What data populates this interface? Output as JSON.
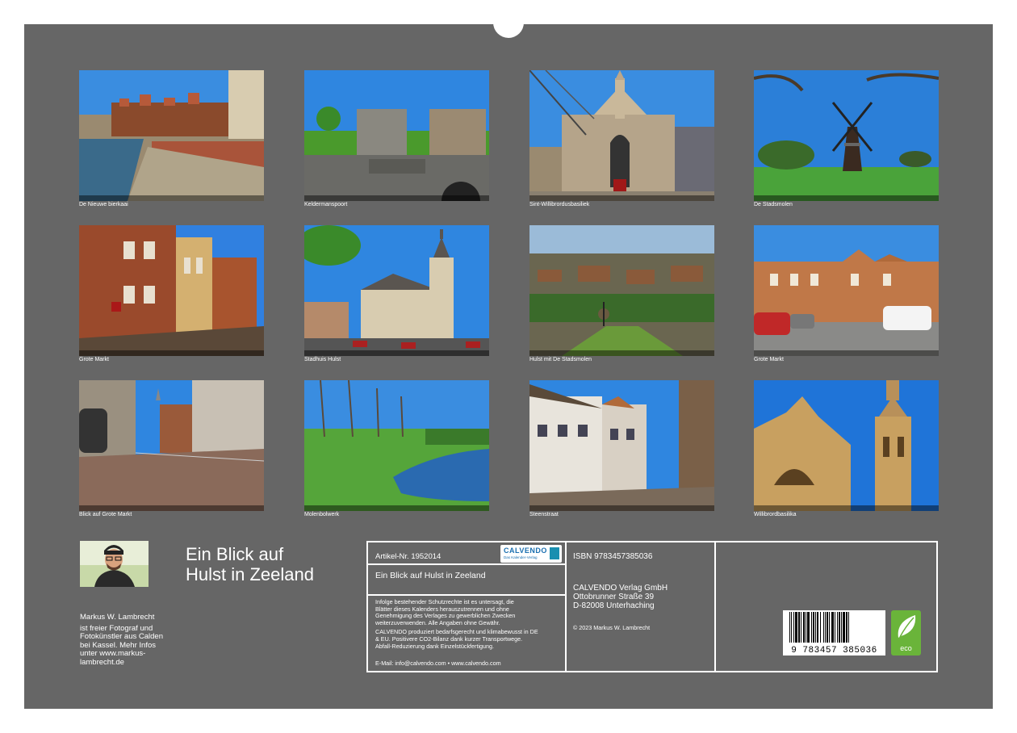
{
  "binding": {
    "hole_count": 51
  },
  "photos": [
    {
      "caption": "De Nieuwe bierkaai",
      "scene": "canal-quay"
    },
    {
      "caption": "Keldermanspoort",
      "scene": "city-gate"
    },
    {
      "caption": "Sint-Willibrordusbasiliek",
      "scene": "basilica-front"
    },
    {
      "caption": "De Stadsmolen",
      "scene": "windmill"
    },
    {
      "caption": "Grote Markt",
      "scene": "market-street"
    },
    {
      "caption": "Stadhuis Hulst",
      "scene": "town-hall"
    },
    {
      "caption": "Hulst mit De Stadsmolen",
      "scene": "aerial"
    },
    {
      "caption": "Grote Markt",
      "scene": "market-cars"
    },
    {
      "caption": "Blick auf Grote Markt",
      "scene": "cobble-street"
    },
    {
      "caption": "Molenbolwerk",
      "scene": "bastion-moat"
    },
    {
      "caption": "Steenstraat",
      "scene": "steenstraat"
    },
    {
      "caption": "Willibrordbasilika",
      "scene": "basilica-tower"
    }
  ],
  "calendar": {
    "title_line1": "Ein Blick auf",
    "title_line2": "Hulst in Zeeland"
  },
  "author": {
    "name": "Markus W. Lambrecht",
    "bio": [
      "ist freier Fotograf und",
      "Fotokünstler aus Calden",
      "bei Kassel. Mehr Infos",
      "unter www.markus-",
      "lambrecht.de"
    ]
  },
  "info": {
    "article": "Artikel-Nr. 1952014",
    "logo_text": "CALVENDO",
    "logo_sub": "Das Kalender-Verlag",
    "product_title": "Ein Blick auf Hulst in Zeeland",
    "legal_1": [
      "Infolge bestehender Schutzrechte ist es untersagt, die",
      "Blätter dieses Kalenders herauszutrennen und ohne",
      "Genehmigung des Verlages zu gewerblichen Zwecken",
      "weiterzuverwenden. Alle Angaben ohne Gewähr."
    ],
    "legal_2": [
      "CALVENDO produziert bedarfsgerecht und klimabewusst in DE",
      "& EU. Positivere CO2-Bilanz dank kurzer Transportwege.",
      "Abfall-Reduzierung dank Einzelstückfertigung."
    ],
    "contact": "E-Mail: info@calvendo.com • www.calvendo.com",
    "isbn": "ISBN 9783457385036",
    "publisher": [
      "CALVENDO Verlag GmbH",
      "Ottobrunner Straße 39",
      "D-82008 Unterhaching"
    ],
    "copyright": "© 2023 Markus W. Lambrecht",
    "barcode_digits": "9 783457 385036",
    "eco_label": "eco"
  },
  "colors": {
    "sheet": "#666666",
    "sky": "#2b7fd8",
    "grass": "#4a9a2c",
    "brick": "#8a4a2c",
    "eco": "#6ab43a"
  }
}
